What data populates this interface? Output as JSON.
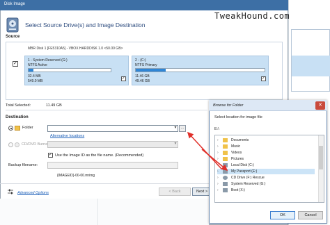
{
  "window": {
    "title": "Disk Image",
    "watermark": "TweakHound.com"
  },
  "header": {
    "title": "Select Source Drive(s) and Image Destination"
  },
  "source": {
    "label": "Source",
    "disk_info": "MBR Disk 1 [FE5310A5] - VBOX HARDDISK 1.0  <50.00 GB>",
    "partitions": [
      {
        "name": "1 - System Reserved (G:)",
        "fs": "NTFS Active",
        "used": "32.4 MB",
        "total": "549.0 MB",
        "fill_fraction": 0.06
      },
      {
        "name": "2 - (C:)",
        "fs": "NTFS Primary",
        "used": "11.46 GB",
        "total": "49.46 GB",
        "fill_fraction": 0.23
      }
    ]
  },
  "total": {
    "label": "Total Selected:",
    "value": "11.49 GB"
  },
  "destination": {
    "label": "Destination",
    "folder_label": "Folder",
    "folder_value": "",
    "browse_label": "...",
    "alt_link": "Alternative locations",
    "cd_label": "CD/DVD Burner",
    "imageid_label": "Use the Image ID as the file name.  (Recommended)",
    "backup_label": "Backup filename:",
    "backup_value": "{IMAGEID}-00-00.mrimg"
  },
  "footer": {
    "advanced": "Advanced Options",
    "back": "< Back",
    "next": "Next >"
  },
  "browse_dialog": {
    "title": "Browse for Folder",
    "prompt": "Select location for image file",
    "path": "E:\\",
    "items": [
      {
        "label": "Documents",
        "icon": "folder-icon",
        "color": "#f0c24a"
      },
      {
        "label": "Music",
        "icon": "music-folder-icon",
        "color": "#f0c24a"
      },
      {
        "label": "Videos",
        "icon": "video-folder-icon",
        "color": "#f0c24a"
      },
      {
        "label": "Pictures",
        "icon": "pictures-folder-icon",
        "color": "#f0c24a"
      },
      {
        "label": "Local Disk (C:)",
        "icon": "drive-icon",
        "color": "#8a9aa9"
      },
      {
        "label": "My Passport (E:)",
        "icon": "drive-icon",
        "color": "#8a9aa9"
      },
      {
        "label": "CD Drive (F:) Rescue",
        "icon": "cd-drive-icon",
        "color": "#8a9aa9"
      },
      {
        "label": "System Reserved (G:)",
        "icon": "drive-icon",
        "color": "#8a9aa9"
      },
      {
        "label": "Boot (X:)",
        "icon": "drive-icon",
        "color": "#8a9aa9"
      }
    ],
    "ok": "OK",
    "cancel": "Cancel"
  },
  "colors": {
    "accent": "#2f86d6",
    "selection": "#cce4f7",
    "annotation_arrow": "#e0302a"
  }
}
